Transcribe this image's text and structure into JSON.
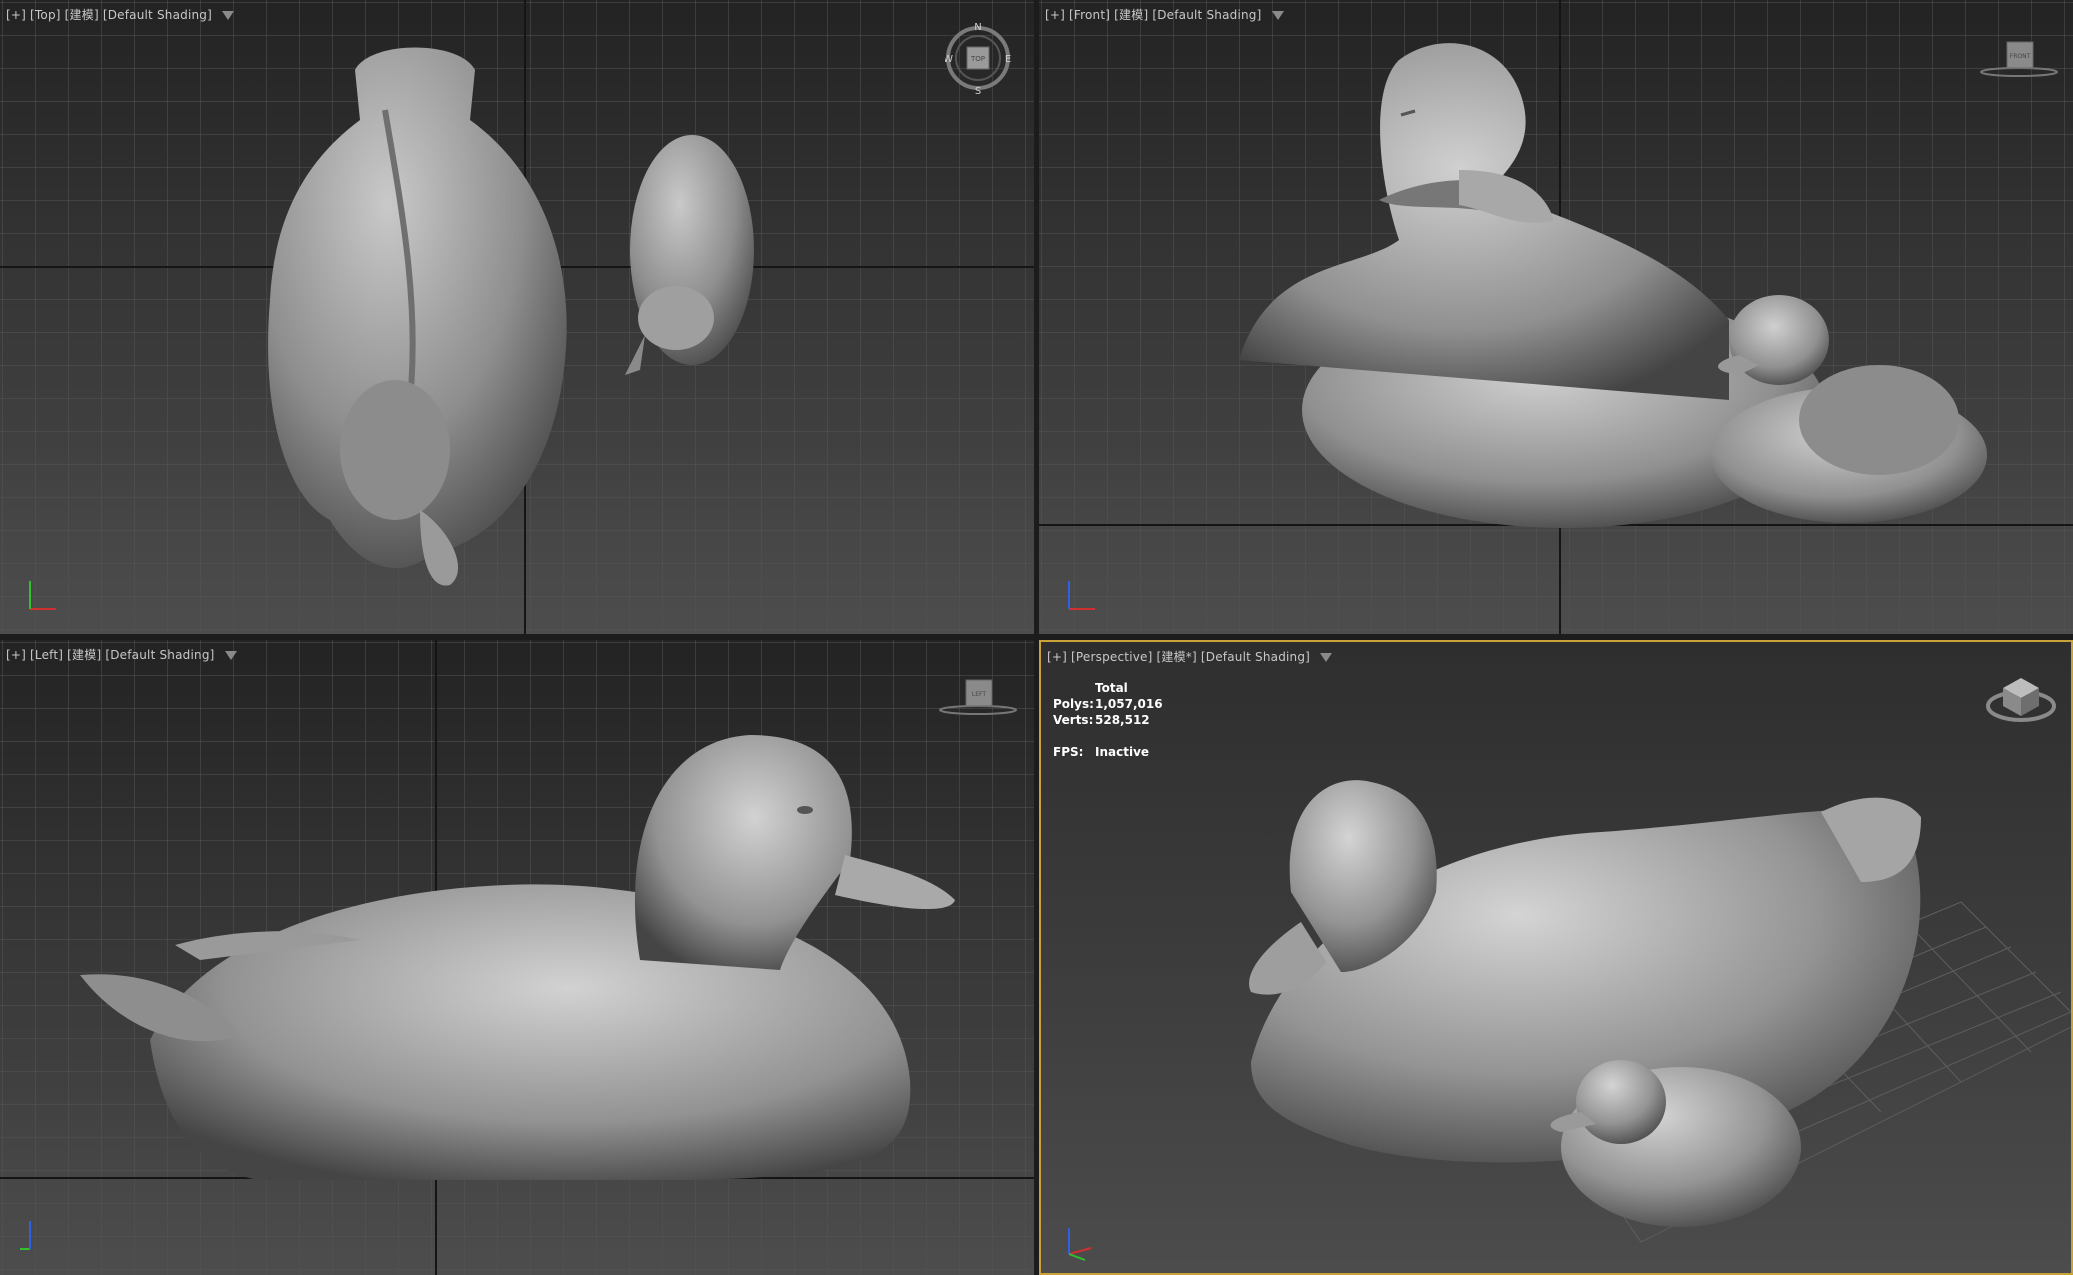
{
  "viewports": [
    {
      "id": "top",
      "labels": [
        "[+]",
        "[Top]",
        "[建模]",
        "[Default Shading]"
      ],
      "active": false,
      "widget": "compass",
      "cube_face": "TOP"
    },
    {
      "id": "front",
      "labels": [
        "[+]",
        "[Front]",
        "[建模]",
        "[Default Shading]"
      ],
      "active": false,
      "widget": "cube",
      "cube_face": "FRONT"
    },
    {
      "id": "left",
      "labels": [
        "[+]",
        "[Left]",
        "[建模]",
        "[Default Shading]"
      ],
      "active": false,
      "widget": "cube",
      "cube_face": "LEFT"
    },
    {
      "id": "perspective",
      "labels": [
        "[+]",
        "[Perspective]",
        "[建模*]",
        "[Default Shading]"
      ],
      "active": true,
      "widget": "viewcube"
    }
  ],
  "compass": {
    "n": "N",
    "s": "S",
    "e": "E",
    "w": "W",
    "face": "TOP"
  },
  "stats": {
    "header": "Total",
    "polys_label": "Polys:",
    "polys_value": "1,057,016",
    "verts_label": "Verts:",
    "verts_value": "528,512",
    "fps_label": "FPS:",
    "fps_value": "Inactive"
  },
  "colors": {
    "active_border": "#c9a23a",
    "grid": "#5a5a5a",
    "model": "#9a9a9a",
    "axis_x": "#d03030",
    "axis_y": "#30c030",
    "axis_z": "#3060e0"
  },
  "icons": [
    "filter-icon",
    "axis-tripod-icon",
    "compass-icon",
    "viewcube-icon"
  ]
}
